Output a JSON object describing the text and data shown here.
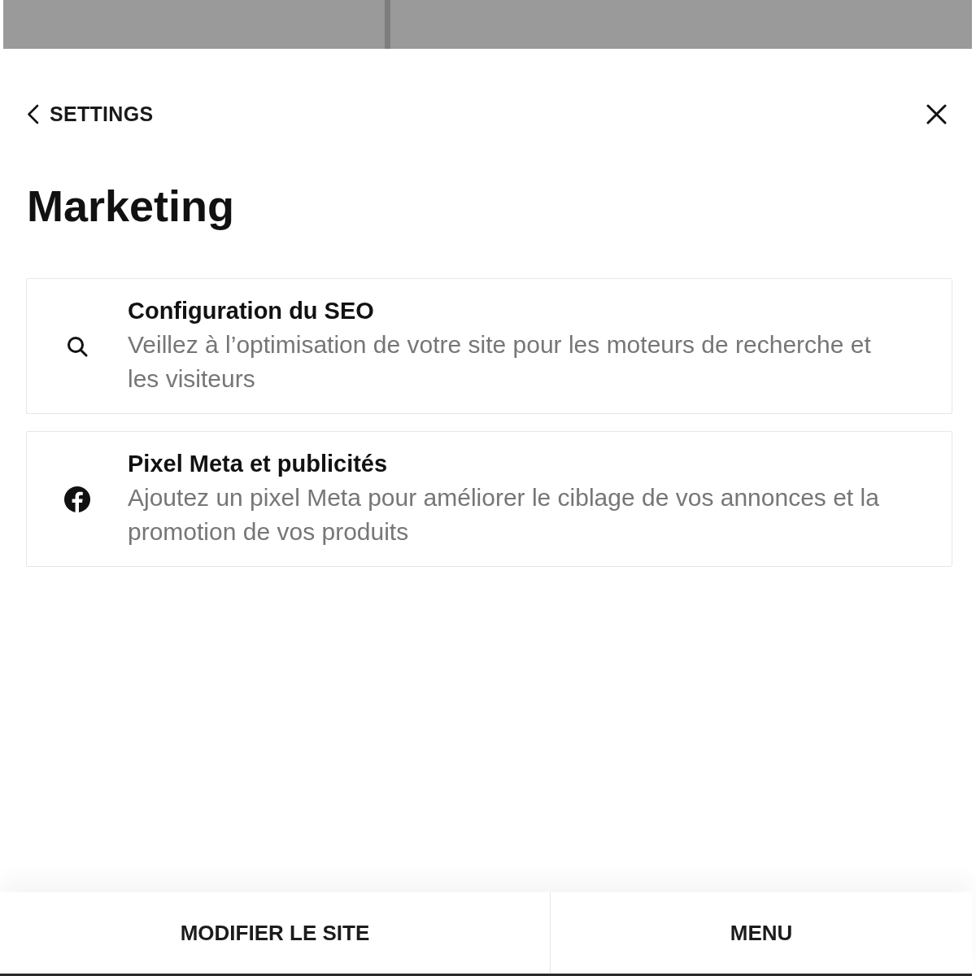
{
  "header": {
    "back_link": "SETTINGS"
  },
  "title": "Marketing",
  "items": [
    {
      "kind": "search",
      "title": "Configuration du SEO",
      "description": "Veillez à l’optimisation de votre site pour les moteurs de recherche et les visiteurs"
    },
    {
      "kind": "facebook",
      "title": "Pixel Meta et publicités",
      "description": "Ajoutez un pixel Meta pour améliorer le ciblage de vos annonces et la promotion de vos produits"
    }
  ],
  "bottom_bar": {
    "buttons": [
      "MODIFIER LE SITE",
      "MENU"
    ]
  }
}
